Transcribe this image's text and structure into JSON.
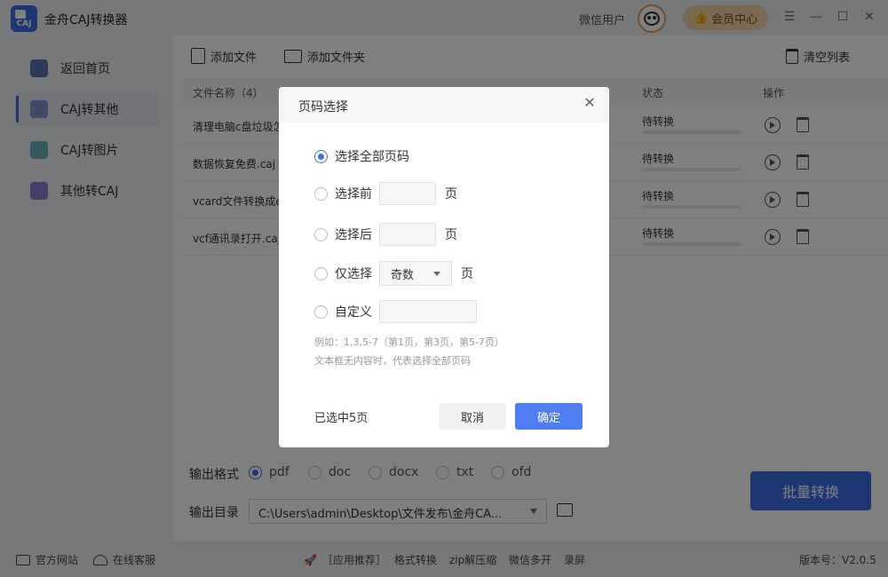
{
  "app": {
    "title": "金舟CAJ转换器",
    "logo_text": "CAJ"
  },
  "titlebar": {
    "user_name": "微信用户",
    "vip_label": "会员中心"
  },
  "sidebar": {
    "items": [
      {
        "label": "返回首页"
      },
      {
        "label": "CAJ转其他"
      },
      {
        "label": "CAJ转图片"
      },
      {
        "label": "其他转CAJ"
      }
    ]
  },
  "toolbar": {
    "add_file": "添加文件",
    "add_folder": "添加文件夹",
    "clear_list": "清空列表"
  },
  "table": {
    "headers": {
      "file_name": "文件名称（4）",
      "status": "状态",
      "action": "操作"
    },
    "rows": [
      {
        "name": "清理电脑c盘垃圾怎",
        "status": "待转换",
        "progress": 0
      },
      {
        "name": "数据恢复免费.caj",
        "status": "待转换",
        "progress": 0
      },
      {
        "name": "vcard文件转换成e",
        "status": "待转换",
        "progress": 0
      },
      {
        "name": "vcf通讯录打开.caj",
        "status": "待转换",
        "progress": 0
      }
    ]
  },
  "output": {
    "format_label": "输出格式",
    "formats": [
      "pdf",
      "doc",
      "docx",
      "txt",
      "ofd"
    ],
    "selected_format": "pdf",
    "dir_label": "输出目录",
    "dir_value": "C:\\Users\\admin\\Desktop\\文件发布\\金舟CA..."
  },
  "batch_button": "批量转换",
  "footer": {
    "website": "官方网站",
    "service": "在线客服",
    "recommend": "［应用推荐］",
    "links": [
      "格式转换",
      "zip解压缩",
      "微信多开",
      "录屏"
    ],
    "version": "版本号：V2.0.5"
  },
  "dialog": {
    "title": "页码选择",
    "options": {
      "all": "选择全部页码",
      "first": "选择前",
      "last": "选择后",
      "only": "仅选择",
      "custom": "自定义"
    },
    "page_unit": "页",
    "only_select_value": "奇数",
    "hint1": "例如：1,3,5-7（第1页，第3页，第5-7页）",
    "hint2": "文本框无内容时，代表选择全部页码",
    "selected_count": "已选中5页",
    "cancel": "取消",
    "confirm": "确定"
  },
  "colors": {
    "accent": "#3d6ee8",
    "vip": "#f4d3a6",
    "confirm": "#4e7ef2"
  }
}
